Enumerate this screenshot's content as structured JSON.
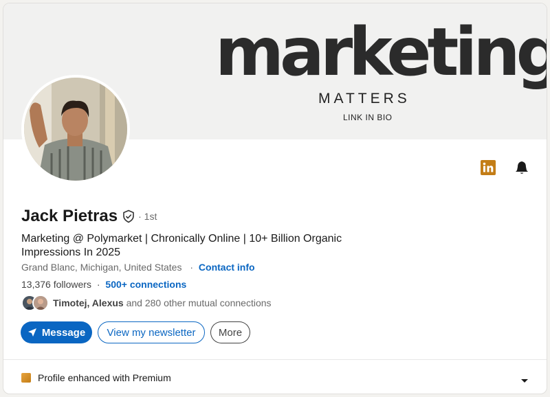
{
  "banner": {
    "big_text": "marketing",
    "mid_text": "MATTERS",
    "small_text": "LINK IN BIO"
  },
  "profile": {
    "name": "Jack Pietras",
    "degree": "· 1st",
    "headline": "Marketing @ Polymarket | Chronically Online | 10+ Billion Organic Impressions In 2025",
    "location": "Grand Blanc, Michigan, United States",
    "location_sep": "·",
    "contact_info": "Contact info",
    "followers": "13,376 followers",
    "followers_sep": "·",
    "connections": "500+ connections",
    "mutual_names": "Timotej, Alexus",
    "mutual_rest": " and 280 other mutual connections"
  },
  "actions": {
    "message": "Message",
    "newsletter": "View my newsletter",
    "more": "More"
  },
  "premium": {
    "label": "Profile enhanced with Premium"
  },
  "icons": {
    "linkedin": "linkedin-icon",
    "bell": "bell-icon",
    "verified": "verified-shield-icon",
    "send": "send-icon",
    "premium": "premium-icon",
    "chevron": "chevron-down-icon"
  },
  "colors": {
    "accent": "#0a66c2",
    "linkedin_badge": "#c37d16",
    "banner_bg": "#f1f1f0"
  }
}
